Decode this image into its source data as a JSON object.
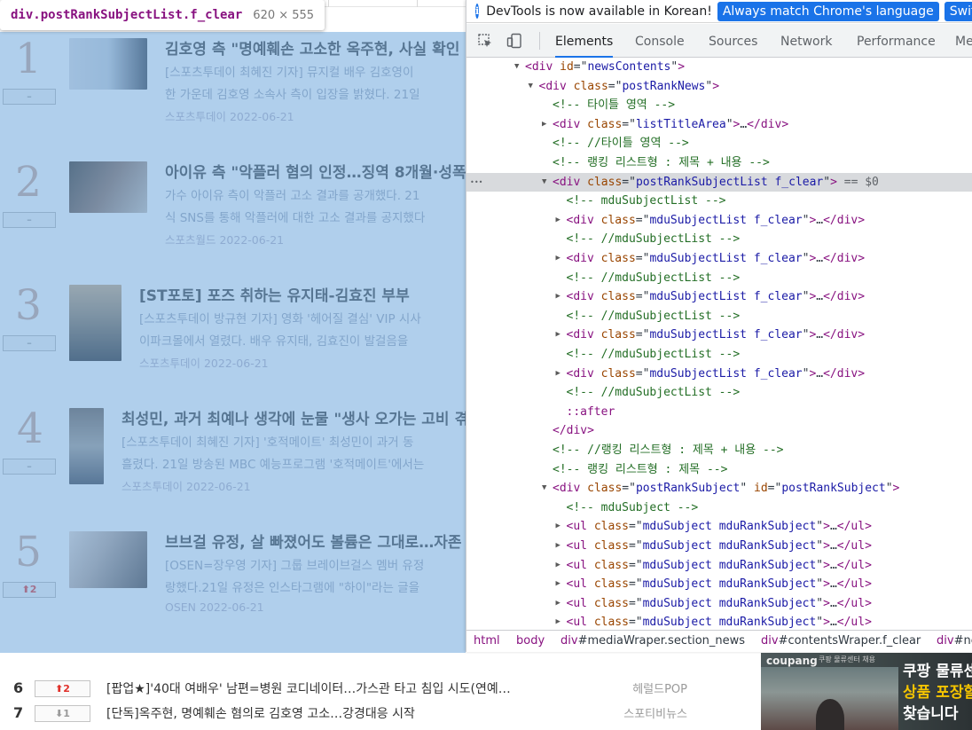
{
  "tooltip": {
    "selector": "div.postRankSubjectList.f_clear",
    "dims": "620 × 555"
  },
  "ranks": [
    {
      "num": "1",
      "badge": "–",
      "badge_type": "none",
      "title": "김호영 측 \"명예훼손 고소한 옥주현, 사실 확인",
      "desc1": "[스포츠투데이 최혜진 기자] 뮤지컬 배우 김호영이",
      "desc2": "한 가운데 김호영 소속사 측이 입장을 밝혔다. 21일",
      "meta": "스포츠투데이 2022-06-21"
    },
    {
      "num": "2",
      "badge": "–",
      "badge_type": "none",
      "title": "아이유 측 \"악플러 혐의 인정…징역 8개월·성폭력",
      "desc1": "가수 아이유 측이 악플러 고소 결과를 공개했다. 21",
      "desc2": "식 SNS를 통해 악플러에 대한 고소 결과를 공지했다",
      "meta": "스포츠월드 2022-06-21"
    },
    {
      "num": "3",
      "badge": "–",
      "badge_type": "none",
      "title": "[ST포토] 포즈 취하는 유지태-김효진 부부",
      "desc1": "[스포츠투데이 방규현 기자] 영화 '헤어질 결심' VIP 시사",
      "desc2": "이파크몰에서 열렸다. 배우 유지태, 김효진이 발걸음을",
      "meta": "스포츠투데이 2022-06-21"
    },
    {
      "num": "4",
      "badge": "–",
      "badge_type": "none",
      "title": "최성민, 과거 최예나 생각에 눈물 \"생사 오가는 고비 겪",
      "desc1": "[스포츠투데이 최혜진 기자] '호적메이트' 최성민이 과거 동",
      "desc2": "흘렸다. 21일 방송된 MBC 예능프로그램 '호적메이트'에서는",
      "meta": "스포츠투데이 2022-06-21"
    },
    {
      "num": "5",
      "badge": "2",
      "badge_type": "up",
      "title": "브브걸 유정, 살 빠졌어도 볼륨은 그대로…자존",
      "desc1": "[OSEN=장우영 기자] 그룹 브레이브걸스 멤버 유정",
      "desc2": "랑했다.21일 유정은 인스타그램에 \"하이\"라는 글을",
      "meta": "OSEN 2022-06-21"
    }
  ],
  "bottom_list": [
    {
      "num": "6",
      "badge": "2",
      "badge_type": "up",
      "title": "[팝업★]'40대 여배우' 남편=병원 코디네이터…가스관 타고 침입 시도(연예…",
      "source": "헤럴드POP"
    },
    {
      "num": "7",
      "badge": "1",
      "badge_type": "down",
      "title": "[단독]옥주현, 명예훼손 혐의로 김호영 고소…강경대응 시작",
      "source": "스포티비뉴스"
    }
  ],
  "ad": {
    "brand": "coupang",
    "small": "쿠팡 물류센터 채용",
    "line1": "쿠팡 물류센",
    "line2": "상품 포장할",
    "line3": "찾습니다"
  },
  "devtools": {
    "info_text": "DevTools is now available in Korean!",
    "btn_match": "Always match Chrome's language",
    "btn_switch": "Switch",
    "tabs": [
      "Elements",
      "Console",
      "Sources",
      "Network",
      "Performance",
      "Me"
    ],
    "active_tab": "Elements",
    "tree": [
      {
        "indent": 4,
        "arrow": "open",
        "kind": "open",
        "tag": "div",
        "attrs": [
          [
            "id",
            "newsContents"
          ]
        ],
        "close": ">"
      },
      {
        "indent": 5,
        "arrow": "open",
        "kind": "open",
        "tag": "div",
        "attrs": [
          [
            "class",
            "postRankNews"
          ]
        ],
        "close": ">"
      },
      {
        "indent": 6,
        "arrow": "",
        "kind": "comment",
        "text": "<!-- 타이틀 영역 -->"
      },
      {
        "indent": 6,
        "arrow": "closed",
        "kind": "collapsed",
        "tag": "div",
        "attrs": [
          [
            "class",
            "listTitleArea"
          ]
        ]
      },
      {
        "indent": 6,
        "arrow": "",
        "kind": "comment",
        "text": "<!-- //타이틀 영역 -->"
      },
      {
        "indent": 6,
        "arrow": "",
        "kind": "comment",
        "text": "<!-- 랭킹 리스트형 : 제목 + 내용 -->"
      },
      {
        "indent": 6,
        "arrow": "open",
        "kind": "open",
        "tag": "div",
        "attrs": [
          [
            "class",
            "postRankSubjectList f_clear"
          ]
        ],
        "close": ">",
        "selected": true,
        "suffix": " == $0"
      },
      {
        "indent": 7,
        "arrow": "",
        "kind": "comment",
        "text": "<!-- mduSubjectList -->"
      },
      {
        "indent": 7,
        "arrow": "closed",
        "kind": "collapsed",
        "tag": "div",
        "attrs": [
          [
            "class",
            "mduSubjectList f_clear"
          ]
        ]
      },
      {
        "indent": 7,
        "arrow": "",
        "kind": "comment",
        "text": "<!-- //mduSubjectList -->"
      },
      {
        "indent": 7,
        "arrow": "closed",
        "kind": "collapsed",
        "tag": "div",
        "attrs": [
          [
            "class",
            "mduSubjectList f_clear"
          ]
        ]
      },
      {
        "indent": 7,
        "arrow": "",
        "kind": "comment",
        "text": "<!-- //mduSubjectList -->"
      },
      {
        "indent": 7,
        "arrow": "closed",
        "kind": "collapsed",
        "tag": "div",
        "attrs": [
          [
            "class",
            "mduSubjectList f_clear"
          ]
        ]
      },
      {
        "indent": 7,
        "arrow": "",
        "kind": "comment",
        "text": "<!-- //mduSubjectList -->"
      },
      {
        "indent": 7,
        "arrow": "closed",
        "kind": "collapsed",
        "tag": "div",
        "attrs": [
          [
            "class",
            "mduSubjectList f_clear"
          ]
        ]
      },
      {
        "indent": 7,
        "arrow": "",
        "kind": "comment",
        "text": "<!-- //mduSubjectList -->"
      },
      {
        "indent": 7,
        "arrow": "closed",
        "kind": "collapsed",
        "tag": "div",
        "attrs": [
          [
            "class",
            "mduSubjectList f_clear"
          ]
        ]
      },
      {
        "indent": 7,
        "arrow": "",
        "kind": "comment",
        "text": "<!-- //mduSubjectList -->"
      },
      {
        "indent": 7,
        "arrow": "",
        "kind": "pseudo",
        "text": "::after"
      },
      {
        "indent": 6,
        "arrow": "",
        "kind": "closetag",
        "text": "</div>"
      },
      {
        "indent": 6,
        "arrow": "",
        "kind": "comment",
        "text": "<!-- //랭킹 리스트형 : 제목 + 내용 -->"
      },
      {
        "indent": 6,
        "arrow": "",
        "kind": "comment",
        "text": "<!-- 랭킹 리스트형 : 제목 -->"
      },
      {
        "indent": 6,
        "arrow": "open",
        "kind": "open",
        "tag": "div",
        "attrs": [
          [
            "class",
            "postRankSubject"
          ],
          [
            "id",
            "postRankSubject"
          ]
        ],
        "close": ">"
      },
      {
        "indent": 7,
        "arrow": "",
        "kind": "comment",
        "text": "<!-- mduSubject -->"
      },
      {
        "indent": 7,
        "arrow": "closed",
        "kind": "collapsed",
        "tag": "ul",
        "attrs": [
          [
            "class",
            "mduSubject mduRankSubject"
          ]
        ]
      },
      {
        "indent": 7,
        "arrow": "closed",
        "kind": "collapsed",
        "tag": "ul",
        "attrs": [
          [
            "class",
            "mduSubject mduRankSubject"
          ]
        ]
      },
      {
        "indent": 7,
        "arrow": "closed",
        "kind": "collapsed",
        "tag": "ul",
        "attrs": [
          [
            "class",
            "mduSubject mduRankSubject"
          ]
        ]
      },
      {
        "indent": 7,
        "arrow": "closed",
        "kind": "collapsed",
        "tag": "ul",
        "attrs": [
          [
            "class",
            "mduSubject mduRankSubject"
          ]
        ]
      },
      {
        "indent": 7,
        "arrow": "closed",
        "kind": "collapsed",
        "tag": "ul",
        "attrs": [
          [
            "class",
            "mduSubject mduRankSubject"
          ]
        ]
      },
      {
        "indent": 7,
        "arrow": "closed",
        "kind": "collapsed",
        "tag": "ul",
        "attrs": [
          [
            "class",
            "mduSubject mduRankSubject"
          ]
        ]
      }
    ],
    "breadcrumbs": [
      {
        "tag": "html",
        "rest": ""
      },
      {
        "tag": "body",
        "rest": ""
      },
      {
        "tag": "div",
        "rest": "#mediaWraper.section_news"
      },
      {
        "tag": "div",
        "rest": "#contentsWraper.f_clear"
      },
      {
        "tag": "div",
        "rest": "#ne"
      }
    ]
  }
}
